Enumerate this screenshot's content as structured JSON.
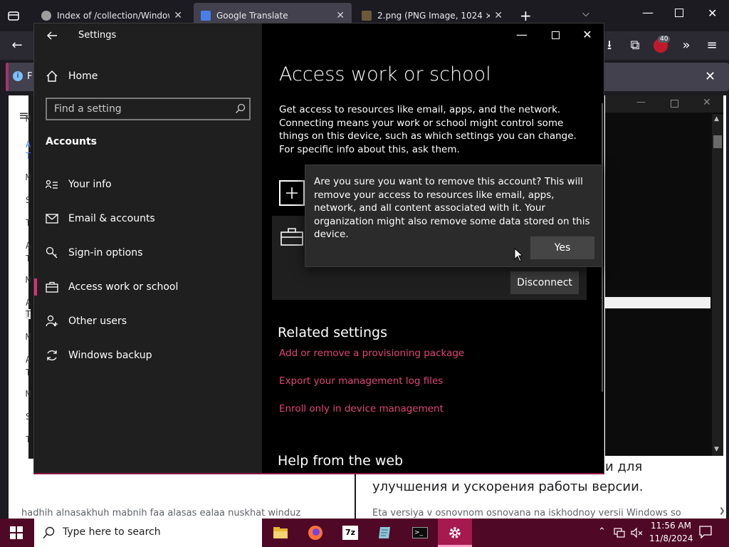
{
  "browser": {
    "tabs": [
      {
        "title": "Index of /collection/Windows X",
        "active": false
      },
      {
        "title": "Google Translate",
        "active": true
      },
      {
        "title": "2.png (PNG Image, 1024 × 768",
        "active": false
      }
    ],
    "extension_badge": "40",
    "infobar_text": "F"
  },
  "background_page": {
    "russian_line1": "и для",
    "russian_line2": "улучшения и ускорения работы версии.",
    "translit_line": "Eta versiya v osnovnom osnovana na iskhodnoy versii Windows so",
    "arabic_translit": "hadhih alnasakhuh mabnih faa alasas ealaa nuskhat winduz",
    "strip_letters": [
      "M",
      "A",
      "T",
      "M",
      "S",
      "T",
      "A",
      "T",
      "M",
      "A",
      "T",
      "M",
      "A",
      "T",
      "M",
      "S",
      "T"
    ]
  },
  "settings": {
    "window_title": "Settings",
    "home_label": "Home",
    "search_placeholder": "Find a setting",
    "section_label": "Accounts",
    "nav": [
      {
        "label": "Your info",
        "icon": "person-list-icon"
      },
      {
        "label": "Email & accounts",
        "icon": "mail-icon"
      },
      {
        "label": "Sign-in options",
        "icon": "key-icon"
      },
      {
        "label": "Access work or school",
        "icon": "briefcase-icon",
        "active": true
      },
      {
        "label": "Other users",
        "icon": "person-add-icon"
      },
      {
        "label": "Windows backup",
        "icon": "sync-icon"
      }
    ],
    "page_title": "Access work or school",
    "description": "Get access to resources like email, apps, and the network. Connecting means your work or school might control some things on this device, such as which settings you can change. For specific info about this, ask them.",
    "disconnect_label": "Disconnect",
    "related_title": "Related settings",
    "links": [
      "Add or remove a provisioning package",
      "Export your management log files",
      "Enroll only in device management"
    ],
    "help_title": "Help from the web",
    "accent": "#d8317b",
    "link_color": "#e0447c"
  },
  "dialog": {
    "message": "Are you sure you want to remove this account? This will remove your access to resources like email, apps, network, and all content associated with it. Your organization might also remove some data stored on this device.",
    "yes_label": "Yes"
  },
  "taskbar": {
    "search_placeholder": "Type here to search",
    "time": "11:56 AM",
    "date": "11/8/2024",
    "apps": [
      "file-explorer-icon",
      "firefox-icon",
      "7zip-icon",
      "notepad-icon",
      "terminal-icon",
      "settings-gear-icon"
    ],
    "color": "#4f0825"
  }
}
